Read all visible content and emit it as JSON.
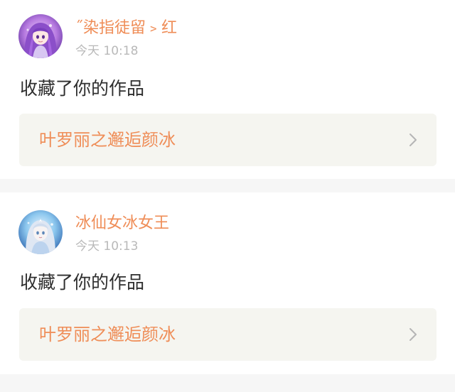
{
  "notifications": [
    {
      "username": "˝染指徒留﹥红",
      "time": "今天 10:18",
      "action": "收藏了你的作品",
      "work_title": "叶罗丽之邂逅颜冰",
      "avatar_icon": "anime-girl-purple-hair-avatar",
      "chevron_icon": "chevron-right-icon"
    },
    {
      "username": "冰仙女冰女王",
      "time": "今天 10:13",
      "action": "收藏了你的作品",
      "work_title": "叶罗丽之邂逅颜冰",
      "avatar_icon": "ice-fairy-queen-avatar",
      "chevron_icon": "chevron-right-icon"
    }
  ],
  "colors": {
    "username": "#ef8d57",
    "timestamp": "#b9b9b9",
    "action_text": "#2e2e2e",
    "work_card_bg": "#f5f5f0",
    "divider_bg": "#f6f6f6"
  }
}
